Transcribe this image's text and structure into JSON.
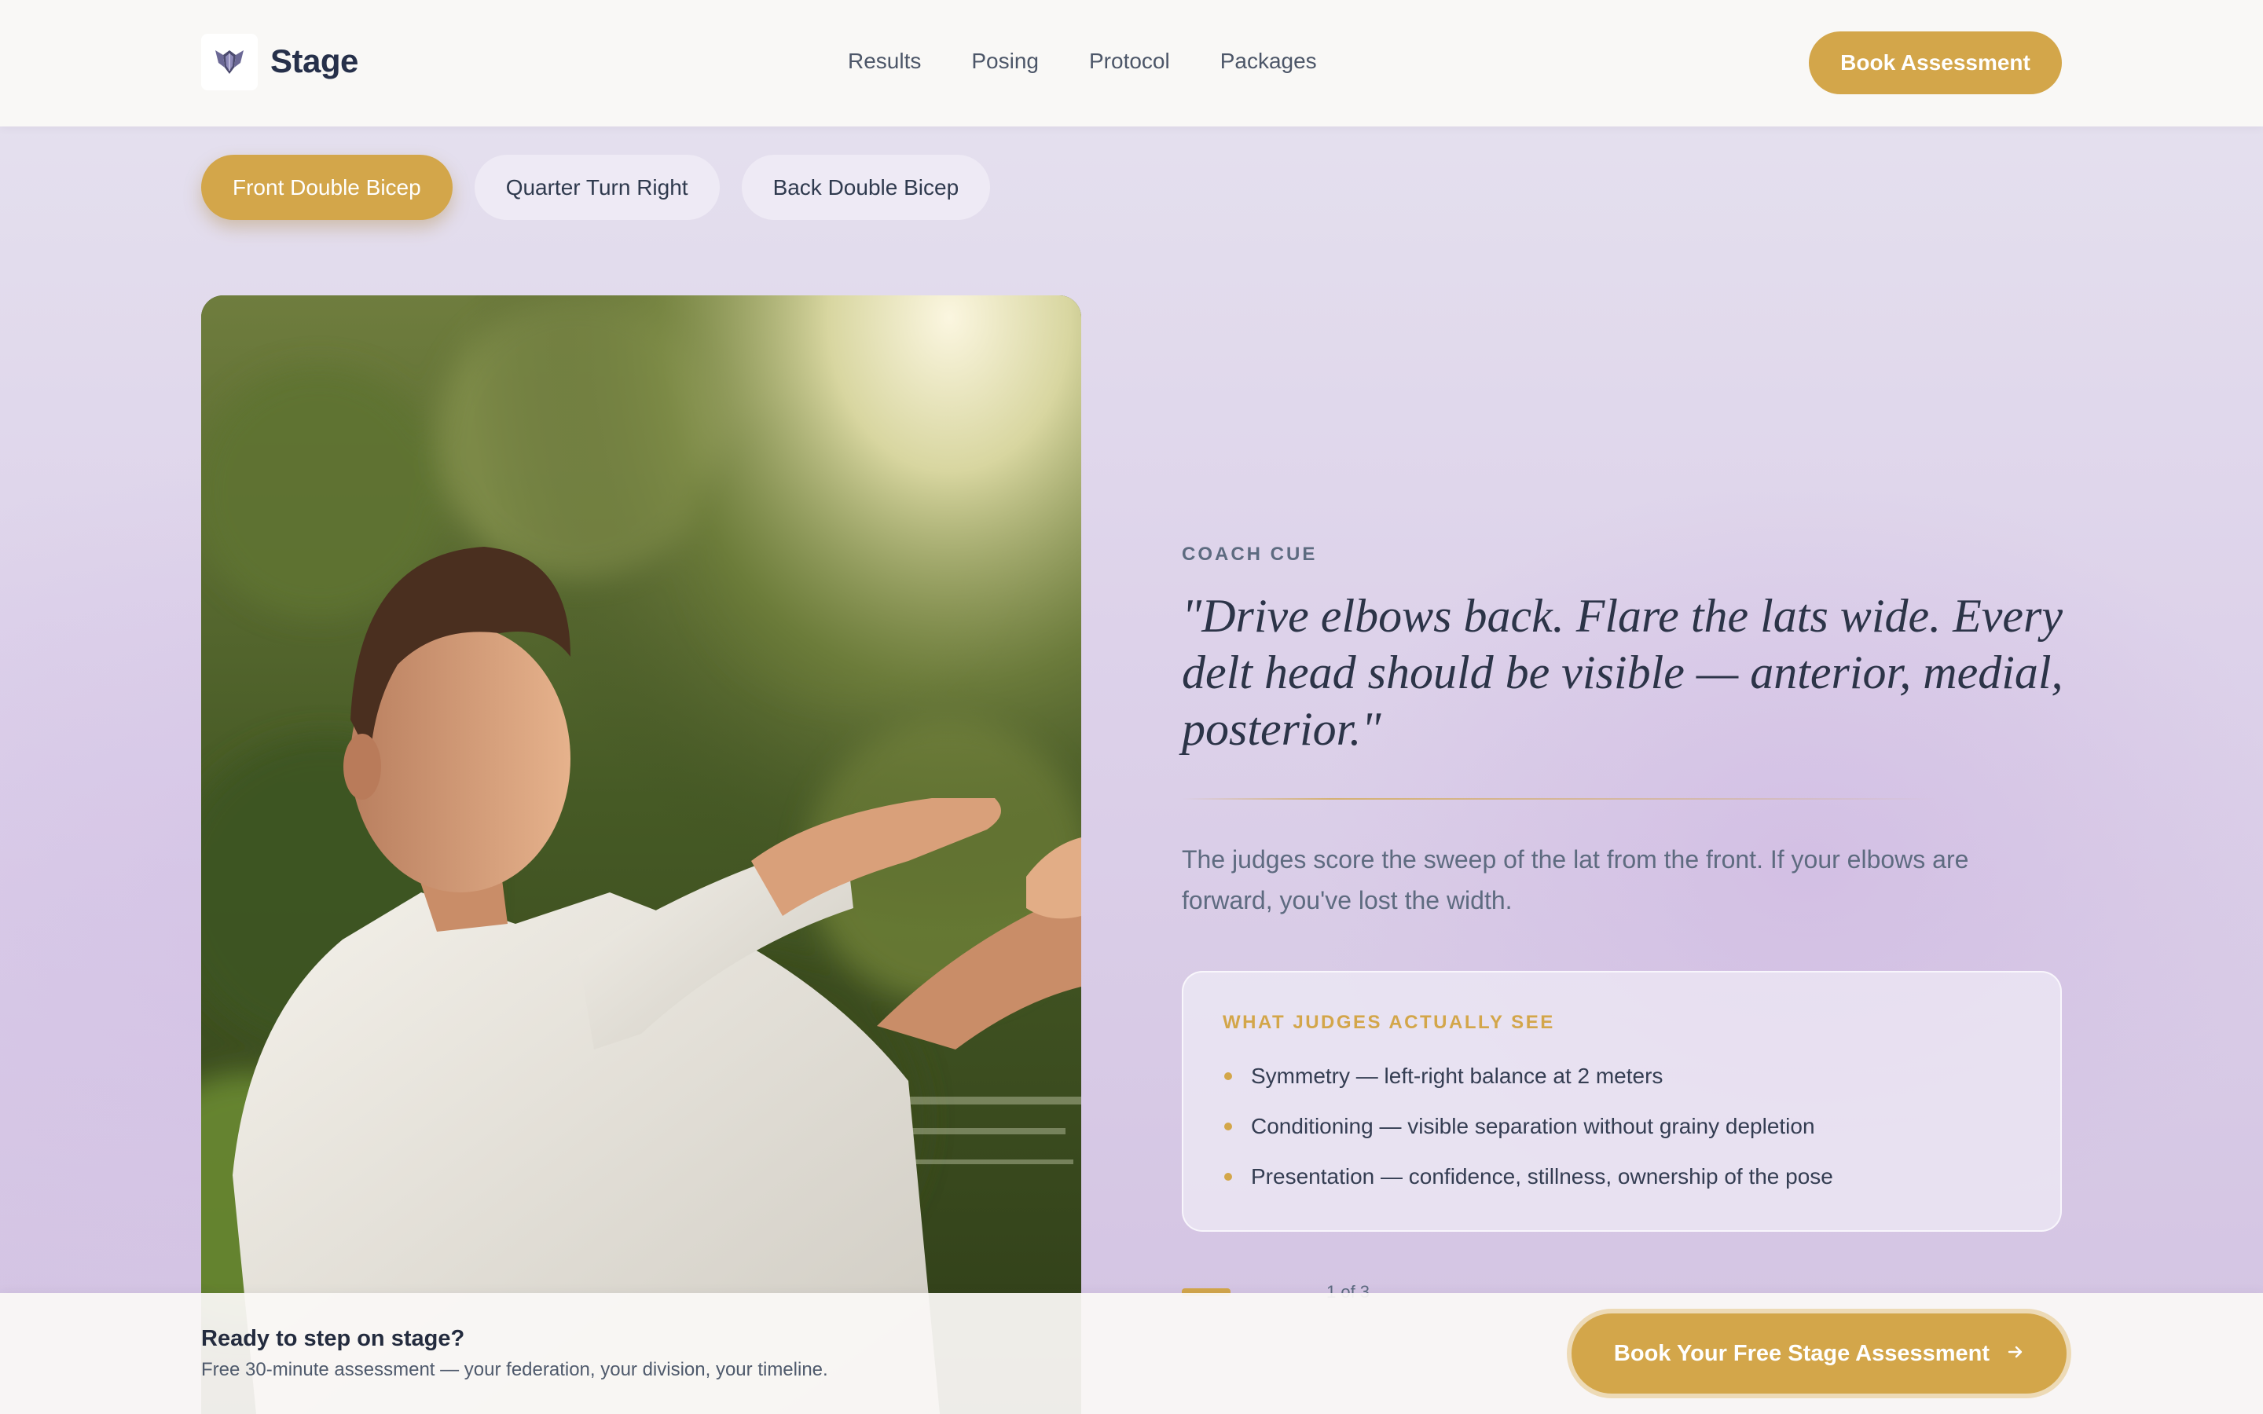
{
  "header": {
    "brand": "Stage",
    "nav": [
      "Results",
      "Posing",
      "Protocol",
      "Packages"
    ],
    "cta": "Book Assessment"
  },
  "tabs": [
    {
      "label": "Front Double Bicep",
      "active": true
    },
    {
      "label": "Quarter Turn Right",
      "active": false
    },
    {
      "label": "Back Double Bicep",
      "active": false
    }
  ],
  "cue": {
    "eyebrow": "COACH CUE",
    "quote": "\"Drive elbows back. Flare the lats wide. Every delt head should be visible — anterior, medial, posterior.\"",
    "description": "The judges score the sweep of the lat from the front. If your elbows are forward, you've lost the width."
  },
  "judges": {
    "title": "WHAT JUDGES ACTUALLY SEE",
    "items": [
      "Symmetry — left-right balance at 2 meters",
      "Conditioning — visible separation without grainy depletion",
      "Presentation — confidence, stillness, ownership of the pose"
    ]
  },
  "pagination": {
    "counter": "1 of 3"
  },
  "cta_bar": {
    "title": "Ready to step on stage?",
    "subtitle": "Free 30-minute assessment — your federation, your division, your timeline.",
    "button": "Book Your Free Stage Assessment"
  },
  "colors": {
    "accent": "#d3a64a",
    "text_dark": "#26304a",
    "text_muted": "#5e6b80",
    "header_bg": "#f9f8f6"
  },
  "icons": {
    "logo": "winged-shield-logo-icon",
    "cta_arrow": "arrow-right-icon"
  }
}
